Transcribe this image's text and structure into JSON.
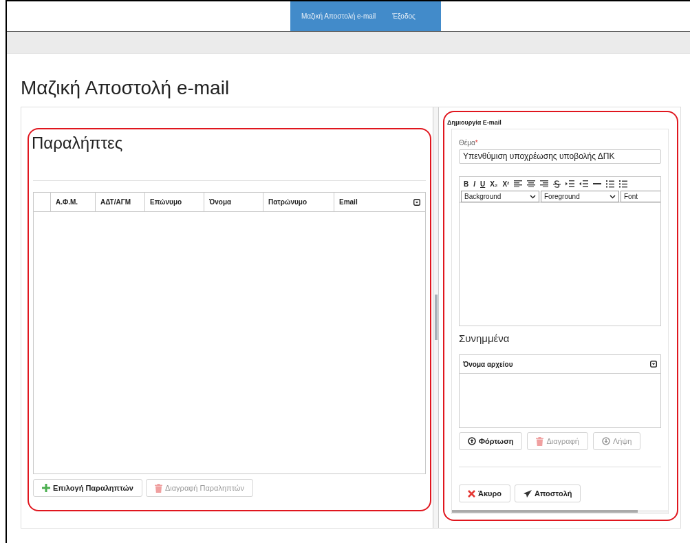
{
  "nav": {
    "links": [
      "Μαζική Αποστολή e-mail",
      "Έξοδος"
    ]
  },
  "title": "Μαζική Αποστολή e-mail",
  "recipients": {
    "heading": "Παραλήπτες",
    "columns": [
      "Α.Φ.Μ.",
      "ΑΔΤ/ΑΓΜ",
      "Επώνυμο",
      "Όνομα",
      "Πατρώνυμο",
      "Email"
    ],
    "buttons": [
      {
        "label": "Επιλογή Παραληπτών",
        "kind": "add",
        "disabled": false
      },
      {
        "label": "Διαγραφή Παραληπτών",
        "kind": "delete",
        "disabled": true
      }
    ]
  },
  "compose": {
    "heading": "Δημιουργία E-mail",
    "subject": {
      "label": "Θέμα",
      "required_mark": "*",
      "value": "Υπενθύμιση υποχρέωσης υποβολής ΔΠΚ"
    },
    "toolbar": [
      {
        "kind": "text",
        "label": "B"
      },
      {
        "kind": "text",
        "label": "I"
      },
      {
        "kind": "text",
        "label": "U"
      },
      {
        "kind": "text",
        "label": "X₂"
      },
      {
        "kind": "text",
        "label": "X²"
      },
      {
        "kind": "align-left"
      },
      {
        "kind": "align-center"
      },
      {
        "kind": "align-right"
      },
      {
        "kind": "strike"
      },
      {
        "kind": "indent"
      },
      {
        "kind": "outdent"
      },
      {
        "kind": "rule"
      },
      {
        "kind": "ordered-list"
      },
      {
        "kind": "bullet-list"
      }
    ],
    "selects": [
      "Background",
      "Foreground",
      "Font"
    ],
    "attachments": {
      "heading": "Συνημμένα",
      "columns": [
        "Όνομα αρχείου"
      ],
      "buttons": [
        {
          "label": "Φόρτωση",
          "kind": "upload",
          "disabled": false
        },
        {
          "label": "Διαγραφή",
          "kind": "delete",
          "disabled": true
        },
        {
          "label": "Λήψη",
          "kind": "download",
          "disabled": true
        }
      ]
    },
    "actions": [
      {
        "label": "Άκυρο",
        "kind": "cancel",
        "disabled": false
      },
      {
        "label": "Αποστολή",
        "kind": "send",
        "disabled": false
      }
    ]
  }
}
